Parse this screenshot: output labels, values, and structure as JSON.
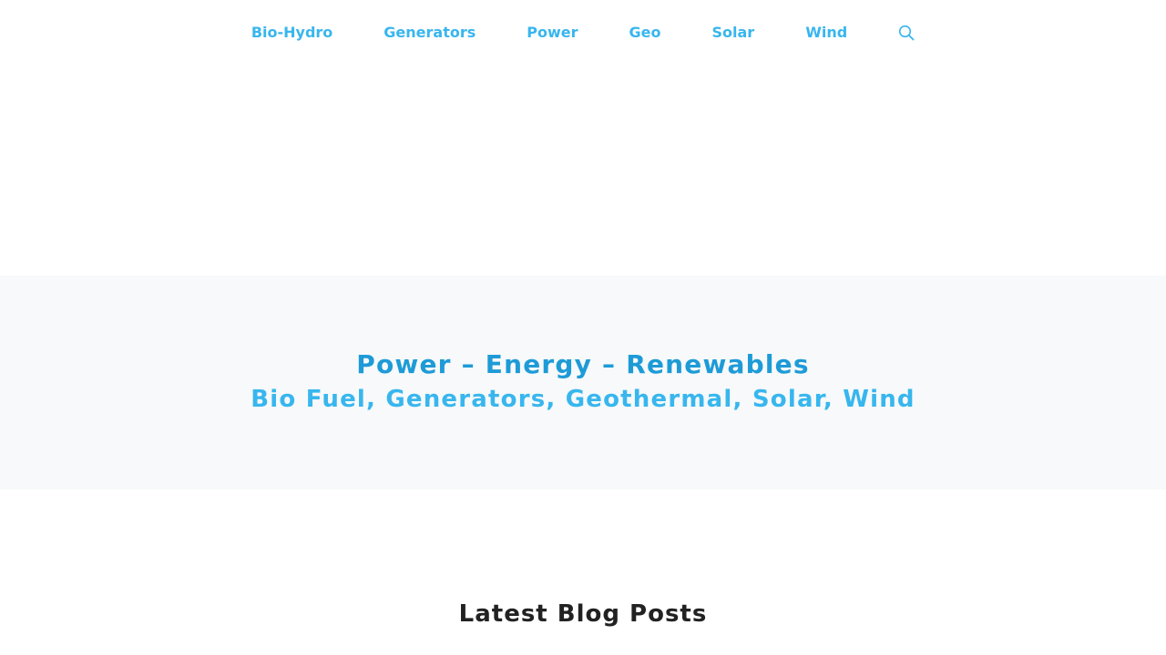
{
  "nav": {
    "items": [
      {
        "label": "Bio-Hydro"
      },
      {
        "label": "Generators"
      },
      {
        "label": "Power"
      },
      {
        "label": "Geo"
      },
      {
        "label": "Solar"
      },
      {
        "label": "Wind"
      }
    ],
    "search_icon": "search-icon"
  },
  "hero": {
    "title": "Power – Energy – Renewables",
    "subtitle": "Bio Fuel, Generators, Geothermal, Solar, Wind"
  },
  "main": {
    "heading": "Latest Blog Posts"
  },
  "colors": {
    "nav_link": "#38b6ee",
    "hero_title": "#1e9bd7",
    "hero_background": "#f7f9fa",
    "heading": "#222222"
  }
}
